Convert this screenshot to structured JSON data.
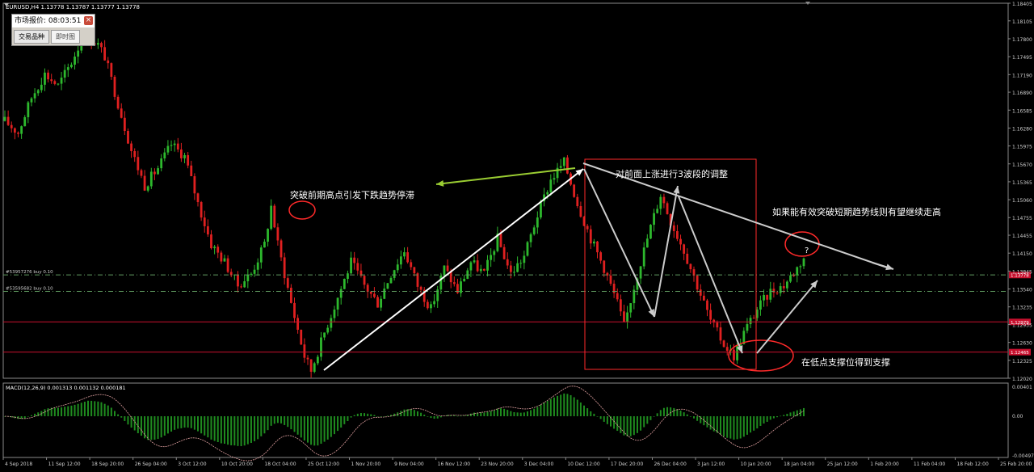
{
  "window": {
    "symbol_header": "EURUSD,H4  1.13778 1.13787 1.13777 1.13778",
    "market_watch": {
      "title": "市场报价: 08:03:51",
      "close_glyph": "×",
      "tabs": [
        {
          "label": "交易品种",
          "active": true
        },
        {
          "label": "即时图",
          "active": false
        }
      ]
    }
  },
  "chart_data": [
    {
      "type": "candlestick",
      "symbol": "EURUSD",
      "timeframe": "H4",
      "ylim": [
        1.1202,
        1.18405
      ],
      "y_ticks": [
        "1.18405",
        "1.18105",
        "1.17800",
        "1.17495",
        "1.17190",
        "1.16890",
        "1.16585",
        "1.16280",
        "1.15975",
        "1.15670",
        "1.15365",
        "1.15060",
        "1.14755",
        "1.14455",
        "1.14150",
        "1.13845",
        "1.13540",
        "1.13235",
        "1.12935",
        "1.12630",
        "1.12325",
        "1.12020"
      ],
      "x_ticks": [
        "4 Sep 2018",
        "11 Sep 12:00",
        "18 Sep 20:00",
        "26 Sep 04:00",
        "3 Oct 12:00",
        "10 Oct 20:00",
        "18 Oct 04:00",
        "25 Oct 12:00",
        "1 Nov 20:00",
        "9 Nov 04:00",
        "16 Nov 12:00",
        "23 Nov 20:00",
        "3 Dec 04:00",
        "10 Dec 12:00",
        "17 Dec 20:00",
        "26 Dec 04:00",
        "3 Jan 12:00",
        "10 Jan 20:00",
        "18 Jan 04:00",
        "25 Jan 12:00",
        "1 Feb 20:00",
        "11 Feb 04:00",
        "18 Feb 12:00",
        "25 Feb 20:00"
      ],
      "price_path": [
        [
          0,
          1.164
        ],
        [
          4,
          1.162
        ],
        [
          8,
          1.168
        ],
        [
          12,
          1.172
        ],
        [
          16,
          1.17
        ],
        [
          20,
          1.174
        ],
        [
          24,
          1.179
        ],
        [
          28,
          1.177
        ],
        [
          30,
          1.175
        ],
        [
          34,
          1.167
        ],
        [
          38,
          1.159
        ],
        [
          42,
          1.153
        ],
        [
          46,
          1.156
        ],
        [
          50,
          1.16
        ],
        [
          54,
          1.158
        ],
        [
          58,
          1.15
        ],
        [
          62,
          1.143
        ],
        [
          66,
          1.14
        ],
        [
          70,
          1.136
        ],
        [
          74,
          1.138
        ],
        [
          78,
          1.143
        ],
        [
          80,
          1.1495
        ],
        [
          82,
          1.143
        ],
        [
          86,
          1.133
        ],
        [
          90,
          1.124
        ],
        [
          92,
          1.1215
        ],
        [
          96,
          1.128
        ],
        [
          100,
          1.134
        ],
        [
          104,
          1.14
        ],
        [
          108,
          1.136
        ],
        [
          112,
          1.133
        ],
        [
          116,
          1.138
        ],
        [
          120,
          1.142
        ],
        [
          124,
          1.136
        ],
        [
          128,
          1.132
        ],
        [
          132,
          1.139
        ],
        [
          136,
          1.135
        ],
        [
          140,
          1.14
        ],
        [
          144,
          1.138
        ],
        [
          148,
          1.144
        ],
        [
          152,
          1.138
        ],
        [
          156,
          1.141
        ],
        [
          160,
          1.148
        ],
        [
          164,
          1.154
        ],
        [
          168,
          1.157
        ],
        [
          172,
          1.15
        ],
        [
          176,
          1.144
        ],
        [
          180,
          1.139
        ],
        [
          184,
          1.133
        ],
        [
          186,
          1.129
        ],
        [
          190,
          1.138
        ],
        [
          194,
          1.146
        ],
        [
          197,
          1.1515
        ],
        [
          200,
          1.147
        ],
        [
          204,
          1.142
        ],
        [
          208,
          1.136
        ],
        [
          212,
          1.13
        ],
        [
          216,
          1.126
        ],
        [
          219,
          1.124
        ],
        [
          222,
          1.128
        ],
        [
          226,
          1.132
        ],
        [
          230,
          1.135
        ],
        [
          234,
          1.136
        ],
        [
          238,
          1.139
        ],
        [
          240,
          1.1408
        ]
      ],
      "current_price": "1.13778"
    },
    {
      "type": "line",
      "name": "MACD(12,26,9)",
      "ylim": [
        -0.004977,
        0.00401
      ],
      "y_ticks": [
        "0.00401",
        "0.00",
        "-0.004977"
      ]
    }
  ],
  "panels": {
    "macd_header": "MACD(12,26,9) 0.001313 0.001132 0.000181",
    "right_markers": [
      {
        "value": "1.13778",
        "bg": "#c8102e"
      },
      {
        "value": "1.12979",
        "bg": "#c8102e"
      },
      {
        "value": "1.12465",
        "bg": "#c8102e"
      }
    ]
  },
  "orders": [
    {
      "label": "#53957276 buy 0.10",
      "price": 1.1378,
      "color": "#5f9a5f"
    },
    {
      "label": "#53595682 buy 0.10",
      "price": 1.135,
      "color": "#5f9a5f"
    }
  ],
  "levels": [
    {
      "price": 1.12979,
      "color": "#c8102e"
    },
    {
      "price": 1.12465,
      "color": "#c8102e"
    }
  ],
  "annotations": {
    "text1": "突破前期高点引发下跌趋势停滞",
    "text2": "对前面上涨进行3波段的调整",
    "text3": "如果能有效突破短期趋势线则有望继续走高",
    "text4": "在低点支撑位得到支撑",
    "question": "?"
  },
  "colors": {
    "bull": "#2db82d",
    "bear": "#e02020",
    "macd_hist": "#1f8c1f",
    "signal": "#e0a0a0",
    "annotation_red": "#ff2a2a",
    "arrow_white": "#ffffff",
    "arrow_green": "#9acd32"
  }
}
